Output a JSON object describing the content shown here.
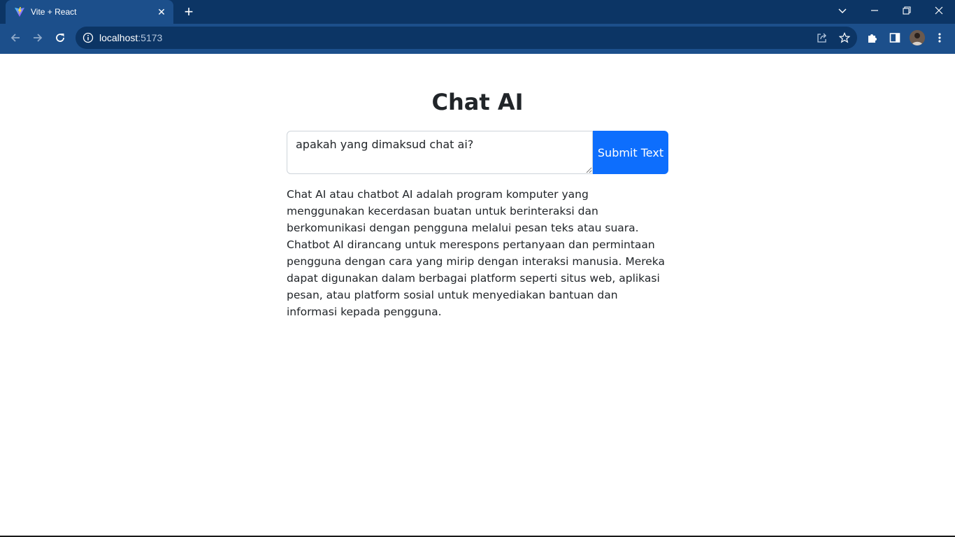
{
  "browser": {
    "tab_title": "Vite + React",
    "url_host": "localhost",
    "url_port": ":5173"
  },
  "page": {
    "title": "Chat AI",
    "input_value": "apakah yang dimaksud chat ai?",
    "submit_label": "Submit Text",
    "answer": "Chat AI atau chatbot AI adalah program komputer yang menggunakan kecerdasan buatan untuk berinteraksi dan berkomunikasi dengan pengguna melalui pesan teks atau suara. Chatbot AI dirancang untuk merespons pertanyaan dan permintaan pengguna dengan cara yang mirip dengan interaksi manusia. Mereka dapat digunakan dalam berbagai platform seperti situs web, aplikasi pesan, atau platform sosial untuk menyediakan bantuan dan informasi kepada pengguna."
  },
  "icons": {
    "favicon": "vite-icon",
    "back": "arrow-left-icon",
    "forward": "arrow-right-icon",
    "reload": "reload-icon",
    "info": "info-icon",
    "share": "share-icon",
    "bookmark": "star-icon",
    "extensions": "puzzle-icon",
    "sidepanel": "side-panel-icon",
    "menu": "kebab-menu-icon"
  },
  "colors": {
    "primary_button": "#0d6efd",
    "chrome_dark": "#0c3565",
    "chrome_light": "#1c4f8b"
  }
}
